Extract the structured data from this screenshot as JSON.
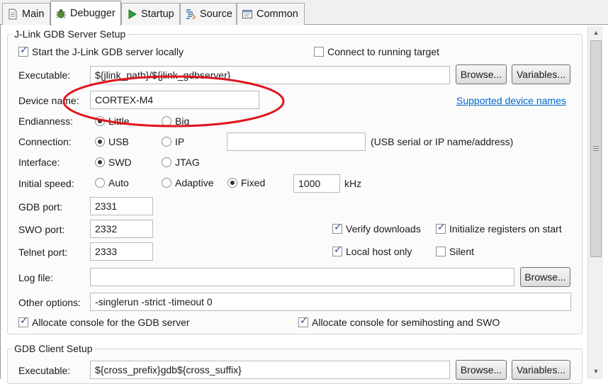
{
  "tabs": [
    {
      "label": "Main",
      "icon": "document-icon"
    },
    {
      "label": "Debugger",
      "icon": "bug-icon",
      "active": true
    },
    {
      "label": "Startup",
      "icon": "play-icon"
    },
    {
      "label": "Source",
      "icon": "source-icon"
    },
    {
      "label": "Common",
      "icon": "window-icon"
    }
  ],
  "server": {
    "legend": "J-Link GDB Server Setup",
    "start_locally": {
      "label": "Start the J-Link GDB server locally",
      "checked": true
    },
    "connect_running": {
      "label": "Connect to running target",
      "checked": false
    },
    "executable": {
      "label": "Executable:",
      "value": "${jlink_path}/${jlink_gdbserver}",
      "browse": "Browse...",
      "variables": "Variables..."
    },
    "device": {
      "label": "Device name:",
      "value": "CORTEX-M4",
      "link": "Supported device names"
    },
    "endianness": {
      "label": "Endianness:",
      "options": [
        "Little",
        "Big"
      ],
      "selected": "Little"
    },
    "connection": {
      "label": "Connection:",
      "options": [
        "USB",
        "IP"
      ],
      "selected": "USB",
      "value": "",
      "hint": "(USB serial or IP name/address)"
    },
    "interface": {
      "label": "Interface:",
      "options": [
        "SWD",
        "JTAG"
      ],
      "selected": "SWD"
    },
    "speed": {
      "label": "Initial speed:",
      "options": [
        "Auto",
        "Adaptive",
        "Fixed"
      ],
      "selected": "Fixed",
      "value": "1000",
      "unit": "kHz"
    },
    "gdb_port": {
      "label": "GDB port:",
      "value": "2331"
    },
    "swo_port": {
      "label": "SWO port:",
      "value": "2332"
    },
    "telnet_port": {
      "label": "Telnet port:",
      "value": "2333"
    },
    "verify_downloads": {
      "label": "Verify downloads",
      "checked": true
    },
    "init_registers": {
      "label": "Initialize registers on start",
      "checked": true
    },
    "local_host_only": {
      "label": "Local host only",
      "checked": true
    },
    "silent": {
      "label": "Silent",
      "checked": false
    },
    "log_file": {
      "label": "Log file:",
      "value": "",
      "browse": "Browse..."
    },
    "other_options": {
      "label": "Other options:",
      "value": "-singlerun -strict -timeout 0"
    },
    "alloc_console_gdb": {
      "label": "Allocate console for the GDB server",
      "checked": true
    },
    "alloc_console_semi": {
      "label": "Allocate console for semihosting and SWO",
      "checked": true
    }
  },
  "client": {
    "legend": "GDB Client Setup",
    "executable": {
      "label": "Executable:",
      "value": "${cross_prefix}gdb${cross_suffix}",
      "browse": "Browse...",
      "variables": "Variables..."
    }
  },
  "colors": {
    "annotation": "#e0151d",
    "link": "#0066cc",
    "check": "#2b4a8a"
  }
}
